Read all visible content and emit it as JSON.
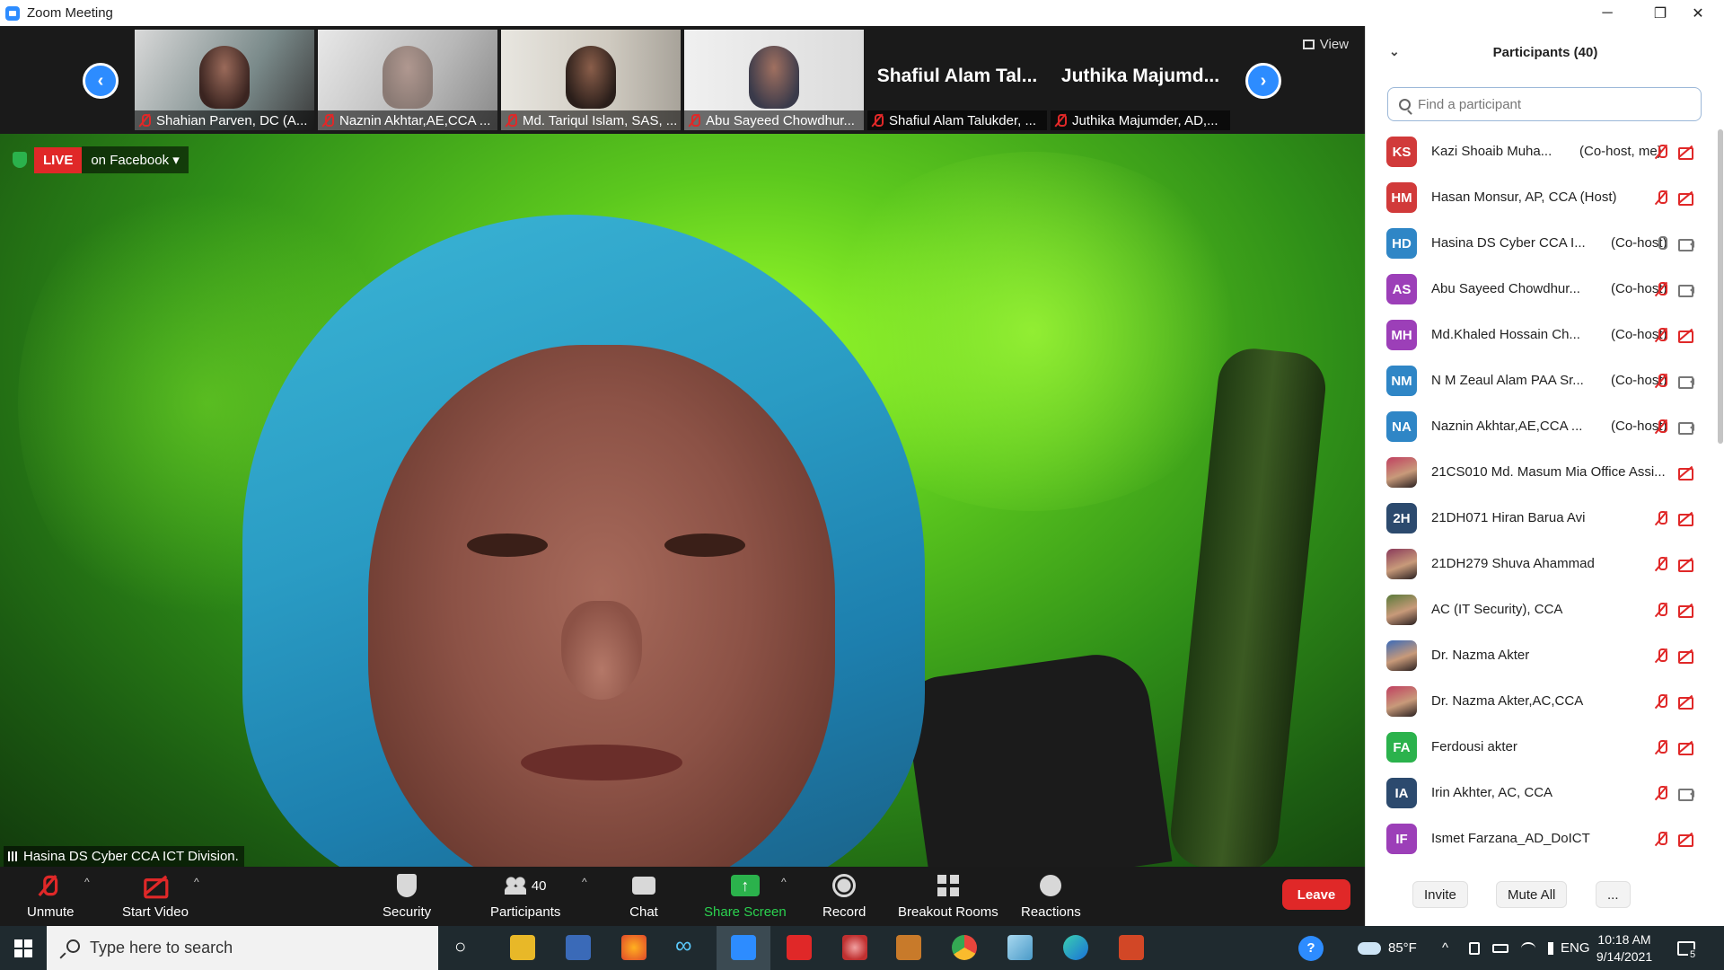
{
  "window": {
    "title": "Zoom Meeting",
    "minimize_glyph": "─",
    "restore_glyph": "❐",
    "close_glyph": "✕"
  },
  "gallery": {
    "prev_glyph": "‹",
    "next_glyph": "›",
    "view_label": "View",
    "thumbs": [
      {
        "name": "Shahian Parven, DC (A..."
      },
      {
        "name": "Naznin Akhtar,AE,CCA ..."
      },
      {
        "name": "Md. Tariqul Islam, SAS, ..."
      },
      {
        "name": "Abu Sayeed Chowdhur..."
      },
      {
        "big_name": "Shafiul Alam Tal...",
        "name": "Shafiul Alam Talukder, ..."
      },
      {
        "big_name": "Juthika Majumd...",
        "name": "Juthika Majumder, AD,..."
      }
    ]
  },
  "main_video": {
    "live_label": "LIVE",
    "live_target": "on Facebook ▾",
    "speaker_name": "Hasina DS Cyber CCA ICT Division."
  },
  "toolbar": {
    "unmute": "Unmute",
    "start_video": "Start Video",
    "security": "Security",
    "participants": "Participants",
    "participants_count": "40",
    "chat": "Chat",
    "share_screen": "Share Screen",
    "record": "Record",
    "breakout_rooms": "Breakout Rooms",
    "reactions": "Reactions",
    "leave": "Leave",
    "caret": "^",
    "share_arrow": "↑"
  },
  "participants_panel": {
    "title": "Participants (40)",
    "collapse_glyph": "⌄",
    "search_placeholder": "Find a participant",
    "invite": "Invite",
    "mute_all": "Mute All",
    "more": "...",
    "items": [
      {
        "initials": "KS",
        "color": "#d13a3a",
        "name": "Kazi Shoaib Muha...",
        "role": "(Co-host, me)",
        "mic": "off",
        "cam": "off"
      },
      {
        "initials": "HM",
        "color": "#d13a3a",
        "name": "Hasan Monsur, AP, CCA (Host)",
        "role": "",
        "mic": "off",
        "cam": "off"
      },
      {
        "initials": "HD",
        "color": "#2f86c6",
        "name": "Hasina DS Cyber CCA I...",
        "role": "(Co-host)",
        "mic": "on",
        "cam": "on"
      },
      {
        "initials": "AS",
        "color": "#9c3fb8",
        "name": "Abu Sayeed Chowdhur...",
        "role": "(Co-host)",
        "mic": "off",
        "cam": "on"
      },
      {
        "initials": "MH",
        "color": "#9c3fb8",
        "name": "Md.Khaled Hossain Ch...",
        "role": "(Co-host)",
        "mic": "off",
        "cam": "off"
      },
      {
        "initials": "NM",
        "color": "#2f86c6",
        "name": "N M Zeaul Alam PAA Sr...",
        "role": "(Co-host)",
        "mic": "off",
        "cam": "on"
      },
      {
        "initials": "NA",
        "color": "#2f86c6",
        "name": "Naznin Akhtar,AE,CCA ...",
        "role": "(Co-host)",
        "mic": "off",
        "cam": "on"
      },
      {
        "initials": "",
        "color": "",
        "name": "21CS010 Md. Masum Mia Office Assi...",
        "role": "",
        "mic": "",
        "cam": "off"
      },
      {
        "initials": "2H",
        "color": "#2c4a6e",
        "name": "21DH071 Hiran Barua Avi",
        "role": "",
        "mic": "off",
        "cam": "off"
      },
      {
        "initials": "",
        "color": "",
        "name": "21DH279 Shuva Ahammad",
        "role": "",
        "mic": "off",
        "cam": "off"
      },
      {
        "initials": "",
        "color": "",
        "name": "AC (IT Security), CCA",
        "role": "",
        "mic": "off",
        "cam": "off"
      },
      {
        "initials": "",
        "color": "",
        "name": "Dr. Nazma Akter",
        "role": "",
        "mic": "off",
        "cam": "off"
      },
      {
        "initials": "",
        "color": "",
        "name": "Dr. Nazma Akter,AC,CCA",
        "role": "",
        "mic": "off",
        "cam": "off"
      },
      {
        "initials": "FA",
        "color": "#2bb24c",
        "name": "Ferdousi akter",
        "role": "",
        "mic": "off",
        "cam": "off"
      },
      {
        "initials": "IA",
        "color": "#2c4a6e",
        "name": "Irin Akhter, AC, CCA",
        "role": "",
        "mic": "off",
        "cam": "on"
      },
      {
        "initials": "IF",
        "color": "#9c3fb8",
        "name": "Ismet Farzana_AD_DoICT",
        "role": "",
        "mic": "off",
        "cam": "off"
      }
    ]
  },
  "taskbar": {
    "search_placeholder": "Type here to search",
    "temperature": "85°F",
    "language": "ENG",
    "time": "10:18 AM",
    "date": "9/14/2021",
    "notification_count": "5",
    "tray_chevron": "^",
    "help_glyph": "?",
    "circle_glyph": "○",
    "infinity_glyph": "∞"
  }
}
